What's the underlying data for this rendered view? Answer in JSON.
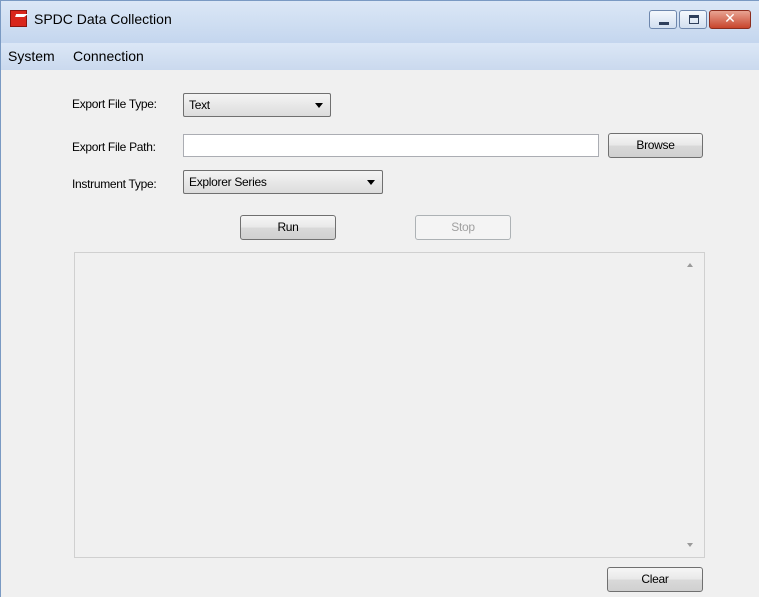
{
  "window": {
    "title": "SPDC Data Collection",
    "close_glyph": "✕"
  },
  "menu": {
    "items": [
      "System",
      "Connection"
    ]
  },
  "form": {
    "export_file_type": {
      "label": "Export File Type:",
      "value": "Text"
    },
    "export_file_path": {
      "label": "Export File Path:",
      "value": "",
      "browse_label": "Browse"
    },
    "instrument_type": {
      "label": "Instrument Type:",
      "value": "Explorer Series"
    }
  },
  "actions": {
    "run_label": "Run",
    "stop_label": "Stop",
    "clear_label": "Clear"
  },
  "output": {
    "text": ""
  },
  "icons": {
    "app": "ohaus-logo-icon",
    "dropdown": "chevron-down-icon"
  },
  "colors": {
    "titlebar": "#c4d6ee",
    "close_button": "#c8452c",
    "window_bg": "#f0f0f0"
  }
}
